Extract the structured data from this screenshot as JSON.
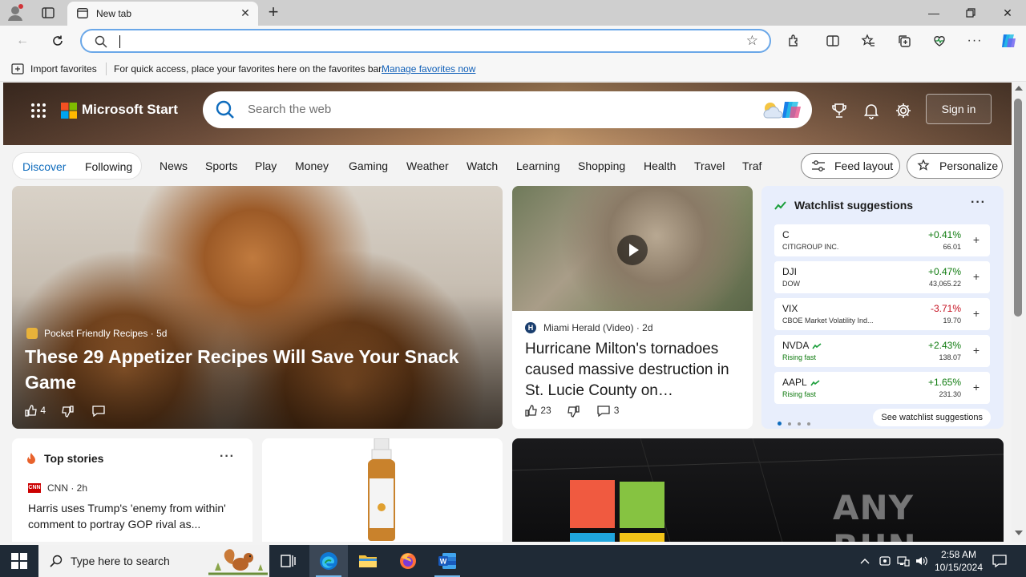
{
  "browser": {
    "tab_title": "New tab",
    "address_placeholder": "",
    "favorites": {
      "import_label": "Import favorites",
      "message": "For quick access, place your favorites here on the favorites bar.",
      "manage_link": "Manage favorites now"
    }
  },
  "header": {
    "brand": "Microsoft Start",
    "search_placeholder": "Search the web",
    "signin_label": "Sign in"
  },
  "nav": {
    "pills": [
      "Discover",
      "Following"
    ],
    "links": [
      "News",
      "Sports",
      "Play",
      "Money",
      "Gaming",
      "Weather",
      "Watch",
      "Learning",
      "Shopping",
      "Health",
      "Travel",
      "Traf"
    ],
    "feed_layout": "Feed layout",
    "personalize": "Personalize"
  },
  "main_story": {
    "source": "Pocket Friendly Recipes",
    "age": "5d",
    "headline": "These 29 Appetizer Recipes Will Save Your Snack Game",
    "likes": "4"
  },
  "news_story": {
    "source": "Miami Herald (Video)",
    "age": "2d",
    "headline": "Hurricane Milton's tornadoes caused massive destruction in St. Lucie County on…",
    "likes": "23",
    "comments": "3"
  },
  "watchlist": {
    "title": "Watchlist suggestions",
    "see_all": "See watchlist suggestions",
    "stocks": [
      {
        "symbol": "C",
        "name": "CITIGROUP INC.",
        "change": "+0.41%",
        "price": "66.01",
        "direction": "up"
      },
      {
        "symbol": "DJI",
        "name": "DOW",
        "change": "+0.47%",
        "price": "43,065.22",
        "direction": "up"
      },
      {
        "symbol": "VIX",
        "name": "CBOE Market Volatility Ind...",
        "change": "-3.71%",
        "price": "19.70",
        "direction": "down"
      },
      {
        "symbol": "NVDA",
        "name": "Rising fast",
        "change": "+2.43%",
        "price": "138.07",
        "direction": "up"
      },
      {
        "symbol": "AAPL",
        "name": "Rising fast",
        "change": "+1.65%",
        "price": "231.30",
        "direction": "up"
      }
    ]
  },
  "top_stories": {
    "title": "Top stories",
    "source": "CNN",
    "age": "2h",
    "headline": "Harris uses Trump's 'enemy from within' comment to portray GOP rival as..."
  },
  "watermark": "ANY RUN",
  "taskbar": {
    "search_placeholder": "Type here to search",
    "time": "2:58 AM",
    "date": "10/15/2024"
  },
  "colors": {
    "accent": "#0f6cbd",
    "up": "#0f7b0f",
    "down": "#c50f1f",
    "taskbar": "#1f2a36"
  }
}
